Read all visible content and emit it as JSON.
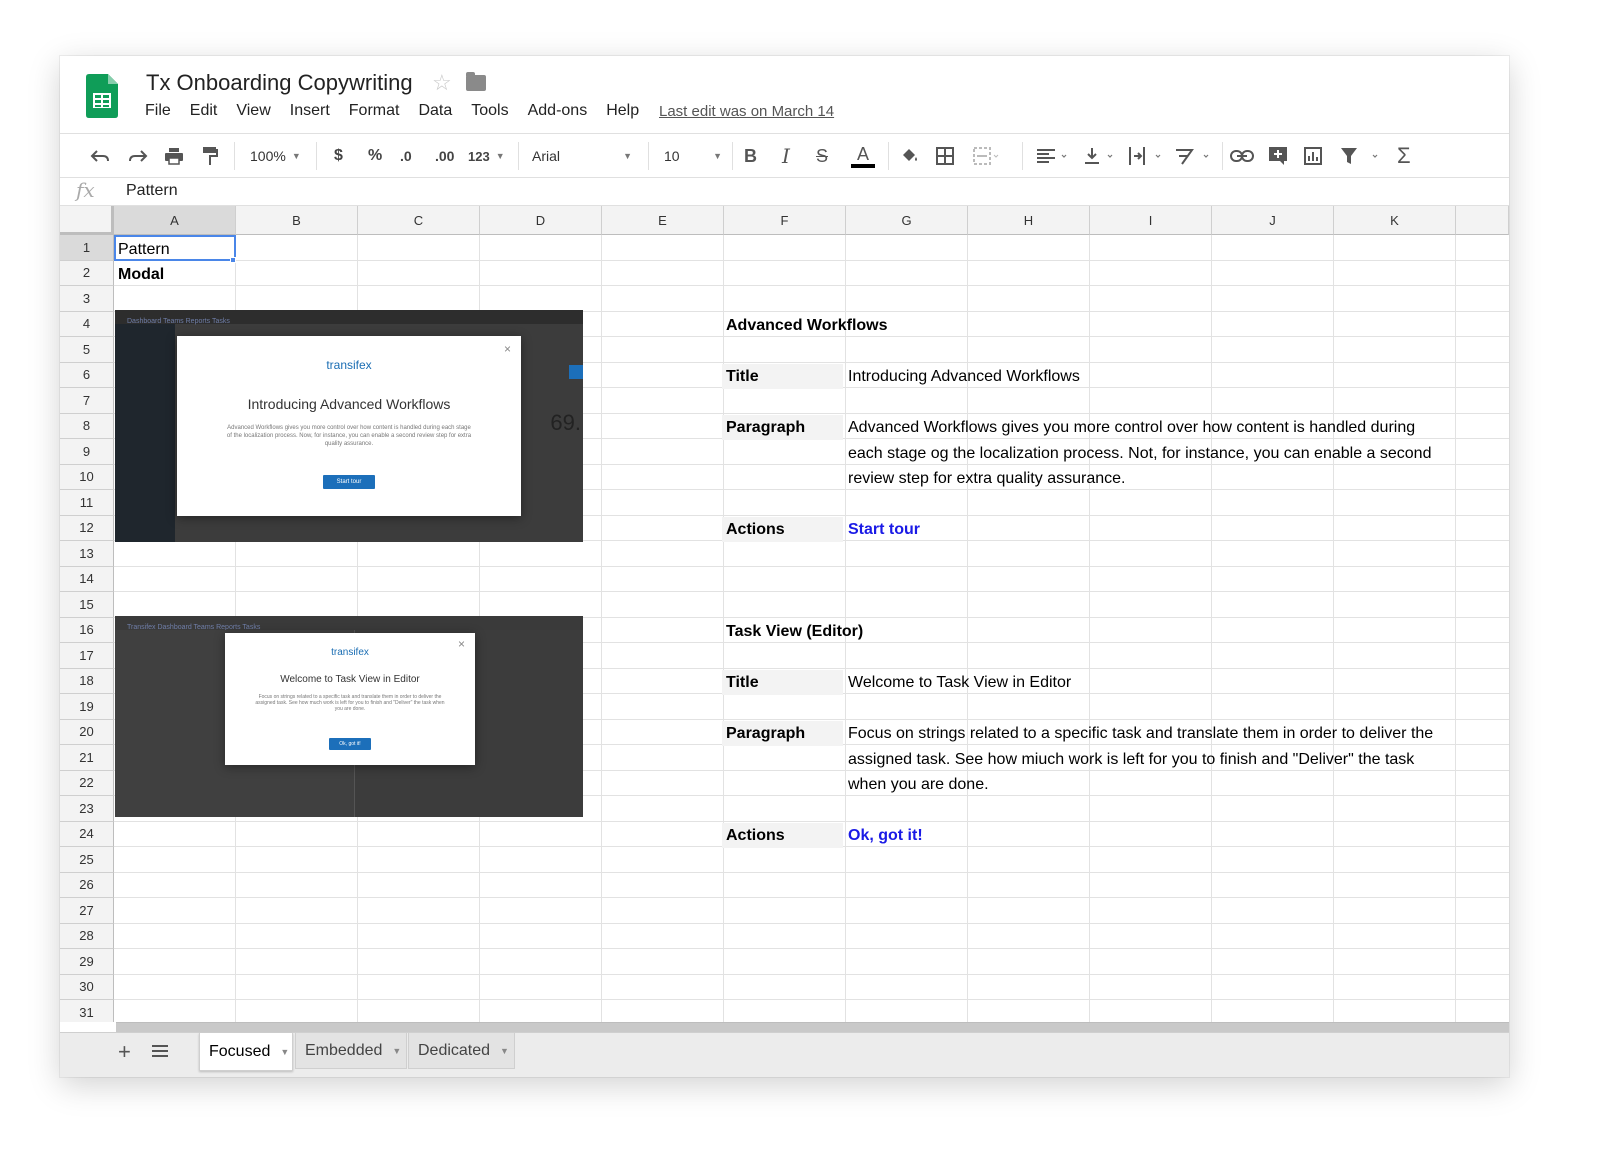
{
  "doc": {
    "title": "Tx Onboarding Copywriting",
    "star_icon": "star-icon",
    "folder_icon": "folder-icon",
    "last_edit": "Last edit was on March 14"
  },
  "menu": [
    "File",
    "Edit",
    "View",
    "Insert",
    "Format",
    "Data",
    "Tools",
    "Add-ons",
    "Help"
  ],
  "toolbar": {
    "zoom": "100%",
    "currency": "$",
    "percent": "%",
    "dec_less": ".0",
    "dec_more": ".00",
    "more_formats": "123",
    "font": "Arial",
    "font_size": "10",
    "bold": "B",
    "italic": "I",
    "strike": "S",
    "text_color": "A",
    "sum": "Σ"
  },
  "formula_bar": {
    "fx": "fx",
    "value": "Pattern"
  },
  "columns": [
    "A",
    "B",
    "C",
    "D",
    "E",
    "F",
    "G",
    "H",
    "I",
    "J",
    "K"
  ],
  "rows": [
    "1",
    "2",
    "3",
    "4",
    "5",
    "6",
    "7",
    "8",
    "9",
    "10",
    "11",
    "12",
    "13",
    "14",
    "15",
    "16",
    "17",
    "18",
    "19",
    "20",
    "21",
    "22",
    "23",
    "24",
    "25",
    "26",
    "27",
    "28",
    "29",
    "30",
    "31"
  ],
  "cells": {
    "a1": "Pattern",
    "a2": "Modal",
    "section1": {
      "heading": "Advanced Workflows",
      "title_label": "Title",
      "title": "Introducing Advanced Workflows",
      "paragraph_label": "Paragraph",
      "paragraph_lines": [
        "Advanced Workflows gives you more  control over how content is handled during",
        "each stage og the localization process. Not, for instance, you can enable a second",
        "review step for extra quality assurance."
      ],
      "actions_label": "Actions",
      "action": "Start tour"
    },
    "section2": {
      "heading": "Task View (Editor)",
      "title_label": "Title",
      "title": "Welcome to Task View in Editor",
      "paragraph_label": "Paragraph",
      "paragraph_lines": [
        "Focus on strings related to a specific task and translate them in order to deliver the",
        "assigned task. See how miuch work is left for you to finish and \"Deliver\" the task",
        "when you are done."
      ],
      "actions_label": "Actions",
      "action": "Ok, got it!"
    }
  },
  "screenshot1": {
    "nav": "Dashboard     Teams     Reports     Tasks",
    "brand": "transifex",
    "title": "Introducing Advanced Workflows",
    "paragraph": "Advanced Workflows gives you more control over how content is handled during each stage of the localization process. Now, for instance, you can enable a second review step for extra quality assurance.",
    "button": "Start tour",
    "close": "×",
    "bg_number": "69."
  },
  "screenshot2": {
    "nav": "Transifex    Dashboard    Teams    Reports    Tasks",
    "brand": "transifex",
    "title": "Welcome to Task View in Editor",
    "paragraph": "Focus on strings related to a specific task and translate them in order to deliver the assigned task. See how much work is left for you to finish and \"Deliver\" the task when you are done.",
    "button": "Ok, got it!",
    "close": "×"
  },
  "sheets": [
    {
      "name": "Focused",
      "active": true
    },
    {
      "name": "Embedded",
      "active": false
    },
    {
      "name": "Dedicated",
      "active": false
    }
  ],
  "colors": {
    "selection": "#4a86e8",
    "link": "#1a1ae6",
    "sheets_green": "#0f9d58"
  }
}
